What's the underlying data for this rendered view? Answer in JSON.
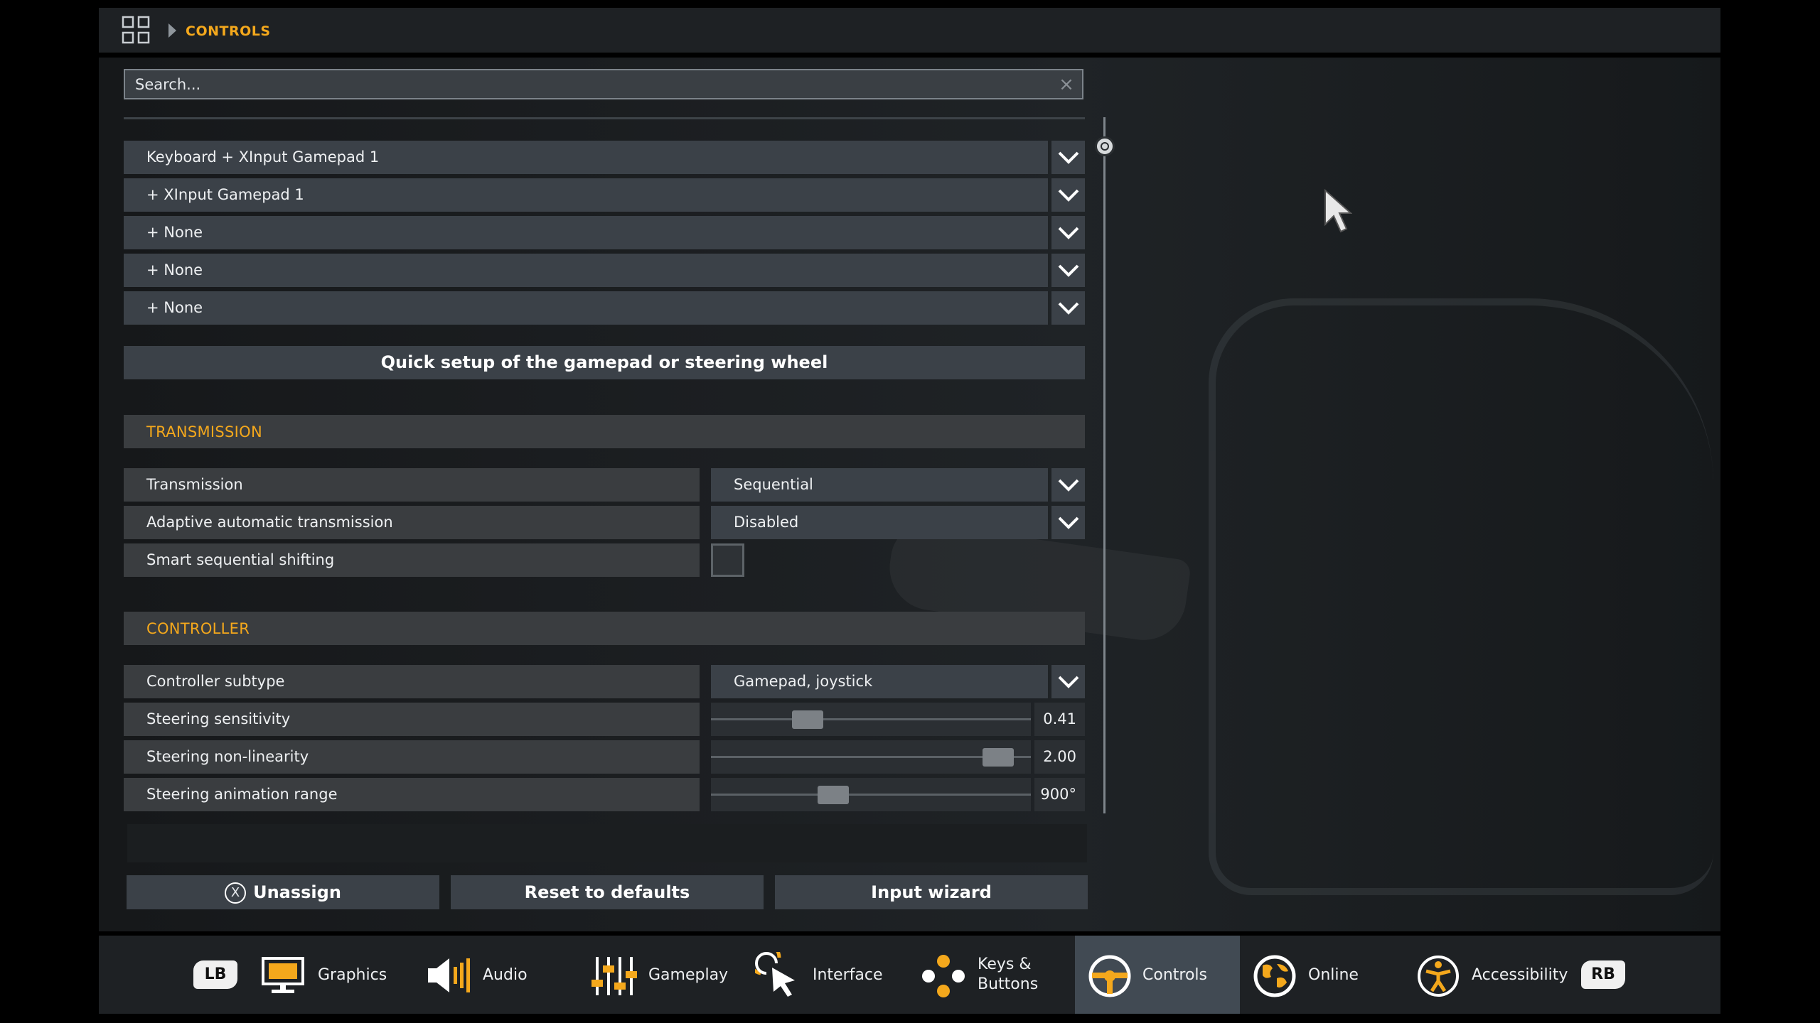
{
  "header": {
    "breadcrumb": "CONTROLS",
    "menu_icon": "grid-icon"
  },
  "search": {
    "placeholder": "Search...",
    "clear_icon": "close-icon"
  },
  "devices": [
    {
      "label": "Keyboard + XInput Gamepad 1"
    },
    {
      "label": "+ XInput Gamepad 1"
    },
    {
      "label": "+ None"
    },
    {
      "label": "+ None"
    },
    {
      "label": "+ None"
    }
  ],
  "quick_setup_label": "Quick setup of the gamepad or steering wheel",
  "transmission": {
    "heading": "TRANSMISSION",
    "rows": {
      "transmission": {
        "label": "Transmission",
        "value": "Sequential"
      },
      "adaptive": {
        "label": "Adaptive automatic transmission",
        "value": "Disabled"
      },
      "smart": {
        "label": "Smart sequential shifting",
        "checked": false
      }
    }
  },
  "controller": {
    "heading": "CONTROLLER",
    "subtype": {
      "label": "Controller subtype",
      "value": "Gamepad, joystick"
    },
    "sliders": [
      {
        "label": "Steering sensitivity",
        "value": "0.41",
        "fraction": 0.28
      },
      {
        "label": "Steering non-linearity",
        "value": "2.00",
        "fraction": 0.94
      },
      {
        "label": "Steering animation range",
        "value": "900°",
        "fraction": 0.37
      }
    ]
  },
  "actions": {
    "unassign": "Unassign",
    "unassign_glyph": "X",
    "reset": "Reset to defaults",
    "wizard": "Input wizard"
  },
  "nav": {
    "lb": "LB",
    "rb": "RB",
    "items": [
      {
        "label": "Graphics",
        "icon": "monitor-icon"
      },
      {
        "label": "Audio",
        "icon": "speaker-icon"
      },
      {
        "label": "Gameplay",
        "icon": "sliders-icon"
      },
      {
        "label": "Interface",
        "icon": "pointer-icon"
      },
      {
        "label_line1": "Keys &",
        "label_line2": "Buttons",
        "icon": "buttons-icon"
      },
      {
        "label": "Controls",
        "icon": "steering-wheel-icon",
        "active": true
      },
      {
        "label": "Online",
        "icon": "globe-icon"
      },
      {
        "label": "Accessibility",
        "icon": "accessibility-icon"
      }
    ]
  },
  "colors": {
    "accent": "#f4a81c",
    "row": "#3b4148",
    "active_tab": "#414a53"
  }
}
